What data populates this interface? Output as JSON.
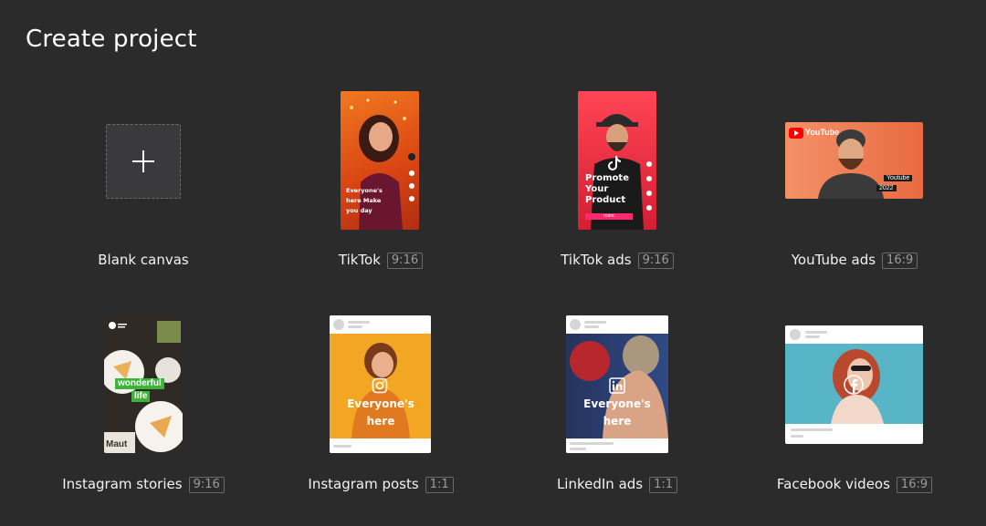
{
  "page": {
    "title": "Create project"
  },
  "cards": [
    {
      "label": "Blank canvas",
      "ratio": ""
    },
    {
      "label": "TikTok",
      "ratio": "9:16",
      "overlay": "Everyone's here Make you day"
    },
    {
      "label": "TikTok ads",
      "ratio": "9:16",
      "overlay": "Promote Your Product",
      "button": "more"
    },
    {
      "label": "YouTube ads",
      "ratio": "16:9",
      "brand": "YouTube",
      "tag1": "Youtube",
      "tag2": "2022"
    },
    {
      "label": "Instagram stories",
      "ratio": "9:16",
      "overlay1": "wonderful",
      "overlay2": "life",
      "corner": "Maut"
    },
    {
      "label": "Instagram posts",
      "ratio": "1:1",
      "overlay": "Everyone's here"
    },
    {
      "label": "LinkedIn ads",
      "ratio": "1:1",
      "overlay": "Everyone's here"
    },
    {
      "label": "Facebook videos",
      "ratio": "16:9"
    }
  ],
  "colors": {
    "background": "#2b2b2c",
    "tiktok_bg": "#e8541a",
    "tiktok_ads_bg": "#e0263a",
    "youtube_bg": "#ec7b55",
    "stories_bg": "#2f2f2f",
    "insta_bg": "#f2a624",
    "linkedin_bg": "#2a3b67",
    "facebook_bg": "#58b4c7",
    "tiktok_ads_button": "#ff2a6d"
  },
  "icons": {
    "add": "plus-icon",
    "instagram": "instagram-icon",
    "linkedin": "linkedin-icon",
    "facebook": "facebook-icon",
    "tiktok": "tiktok-icon",
    "youtube": "youtube-icon"
  }
}
